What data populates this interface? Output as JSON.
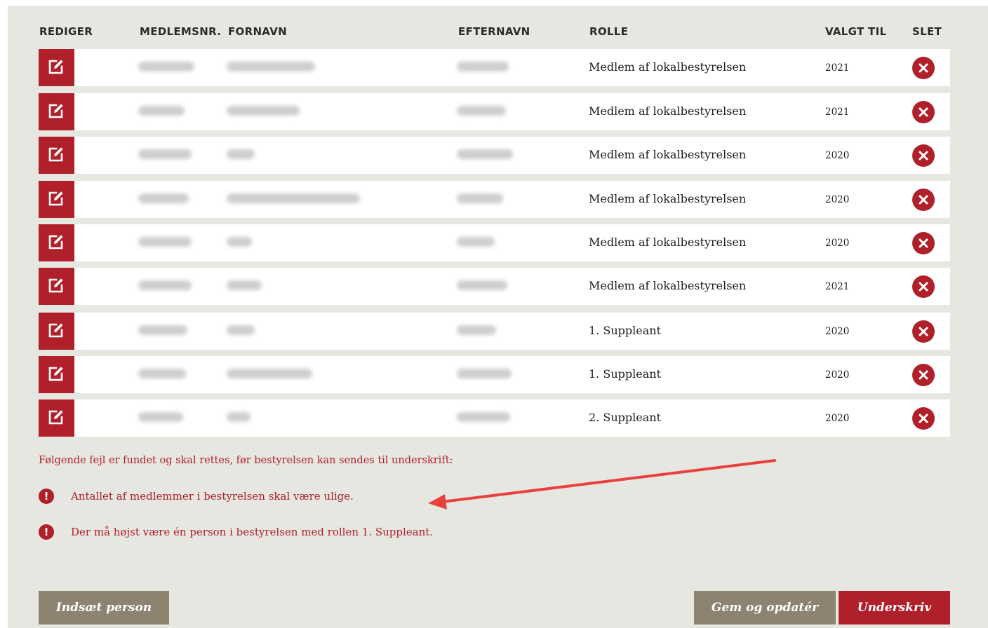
{
  "table": {
    "headers": {
      "edit": "REDIGER",
      "member_no": "MEDLEMSNR.",
      "first_name": "FORNAVN",
      "last_name": "EFTERNAVN",
      "role": "ROLLE",
      "elected_until": "VALGT TIL",
      "delete": "SLET"
    },
    "rows": [
      {
        "role": "Medlem af lokalbestyrelsen",
        "elected_until": "2021"
      },
      {
        "role": "Medlem af lokalbestyrelsen",
        "elected_until": "2021"
      },
      {
        "role": "Medlem af lokalbestyrelsen",
        "elected_until": "2020"
      },
      {
        "role": "Medlem af lokalbestyrelsen",
        "elected_until": "2020"
      },
      {
        "role": "Medlem af lokalbestyrelsen",
        "elected_until": "2020"
      },
      {
        "role": "Medlem af lokalbestyrelsen",
        "elected_until": "2021"
      },
      {
        "role": "1. Suppleant",
        "elected_until": "2020"
      },
      {
        "role": "1. Suppleant",
        "elected_until": "2020"
      },
      {
        "role": "2. Suppleant",
        "elected_until": "2020"
      }
    ]
  },
  "errors": {
    "intro": "Følgende fejl er fundet og skal rettes, før bestyrelsen kan sendes til underskrift:",
    "items": [
      "Antallet af medlemmer i bestyrelsen skal være ulige.",
      "Der må højst være én person i bestyrelsen med rollen 1. Suppleant."
    ]
  },
  "buttons": {
    "insert_person": "Indsæt person",
    "save_update": "Gem og opdatér",
    "sign": "Underskriv"
  },
  "icons": {
    "edit": "edit-icon",
    "delete": "close-circle-icon",
    "error": "exclamation-circle-icon"
  },
  "colors": {
    "accent_red": "#b0202a",
    "button_grey": "#8c8471",
    "panel_bg": "#e7e7e2",
    "annotation_arrow": "#e8413f"
  }
}
